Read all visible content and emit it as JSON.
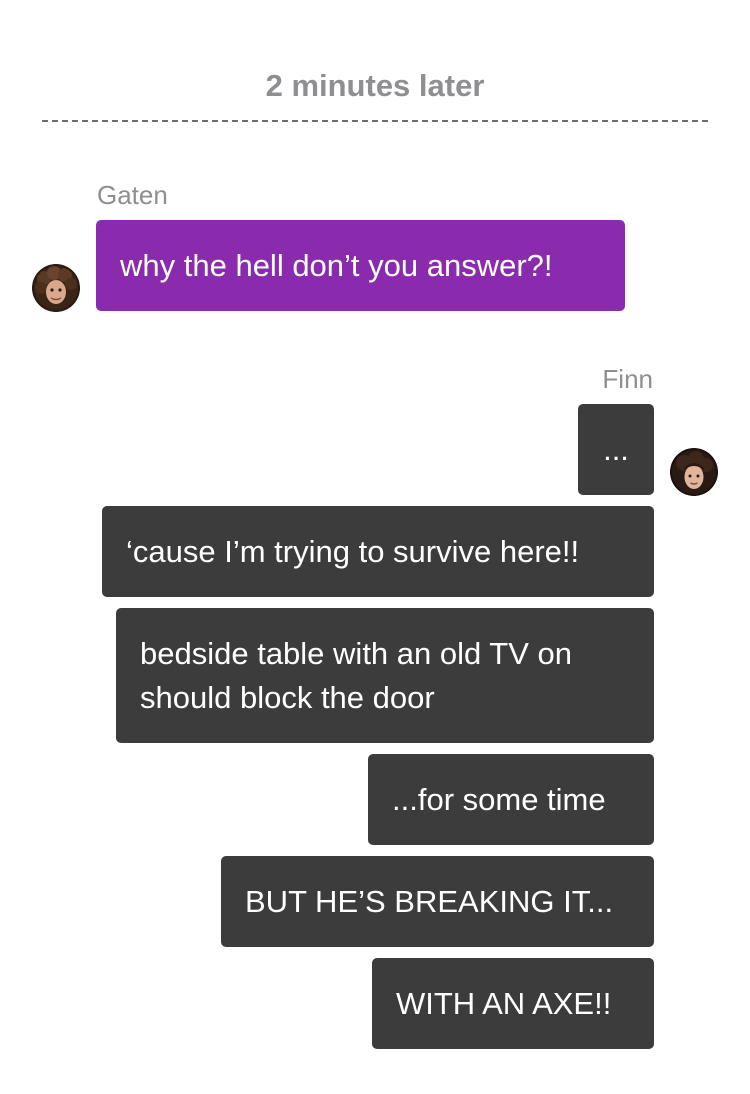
{
  "divider": {
    "label": "2 minutes later"
  },
  "messages": [
    {
      "sender": "Gaten",
      "side": "left",
      "bubble_color": "#8a2bad",
      "items": [
        {
          "text": "why the hell don’t you answer?!"
        }
      ]
    },
    {
      "sender": "Finn",
      "side": "right",
      "bubble_color": "#3c3c3c",
      "items": [
        {
          "text": "..."
        },
        {
          "text": "‘cause I’m trying to survive here!!"
        },
        {
          "text": "bedside table with an old TV on should block the door"
        },
        {
          "text": "...for some time"
        },
        {
          "text": "BUT HE’S BREAKING IT..."
        },
        {
          "text": "WITH AN AXE!!"
        }
      ]
    }
  ],
  "colors": {
    "background": "#ffffff",
    "meta_text": "#8e8e93",
    "purple_bubble": "#8a2bad",
    "dark_bubble": "#3c3c3c",
    "bubble_text": "#ffffff"
  },
  "icons": {
    "gaten_avatar": "curly-hair-avatar-icon",
    "finn_avatar": "dark-hair-avatar-icon"
  }
}
